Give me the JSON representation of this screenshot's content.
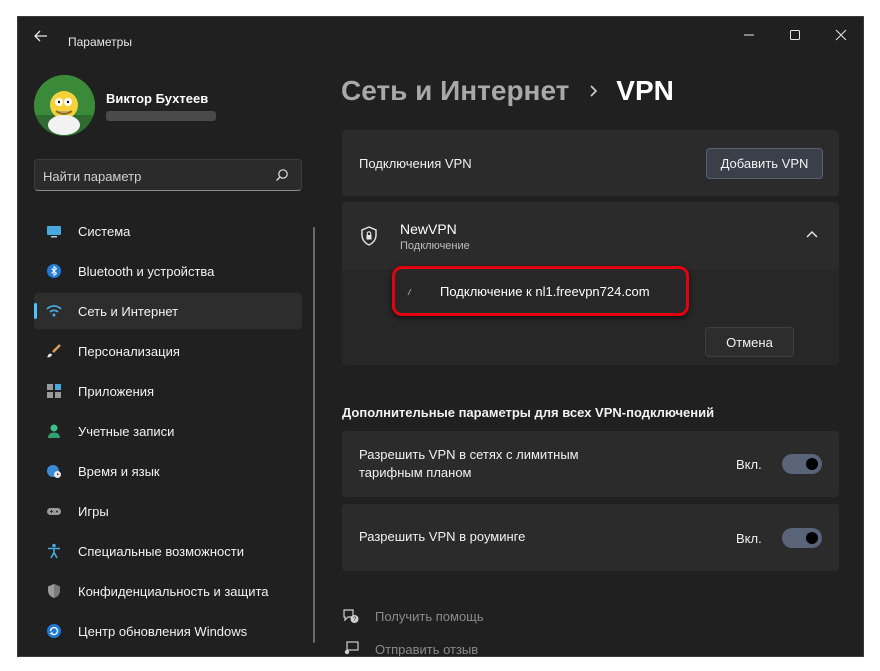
{
  "window": {
    "title": "Параметры",
    "controls": {
      "minimize": "minimize",
      "maximize": "maximize",
      "close": "close"
    }
  },
  "profile": {
    "name": "Виктор Бухтеев"
  },
  "search": {
    "placeholder": "Найти параметр"
  },
  "nav": {
    "items": [
      {
        "label": "Система",
        "icon": "monitor-icon",
        "active": false
      },
      {
        "label": "Bluetooth и устройства",
        "icon": "bluetooth-icon",
        "active": false
      },
      {
        "label": "Сеть и Интернет",
        "icon": "wifi-icon",
        "active": true
      },
      {
        "label": "Персонализация",
        "icon": "brush-icon",
        "active": false
      },
      {
        "label": "Приложения",
        "icon": "apps-icon",
        "active": false
      },
      {
        "label": "Учетные записи",
        "icon": "person-icon",
        "active": false
      },
      {
        "label": "Время и язык",
        "icon": "globe-clock-icon",
        "active": false
      },
      {
        "label": "Игры",
        "icon": "gamepad-icon",
        "active": false
      },
      {
        "label": "Специальные возможности",
        "icon": "accessibility-icon",
        "active": false
      },
      {
        "label": "Конфиденциальность и защита",
        "icon": "shield-icon",
        "active": false
      },
      {
        "label": "Центр обновления Windows",
        "icon": "update-icon",
        "active": false
      }
    ]
  },
  "breadcrumb": {
    "parent": "Сеть и Интернет",
    "current": "VPN"
  },
  "vpn_connections": {
    "label": "Подключения VPN",
    "add_button": "Добавить VPN"
  },
  "vpn_entry": {
    "name": "NewVPN",
    "status": "Подключение",
    "connecting_text": "Подключение к nl1.freevpn724.com",
    "cancel_button": "Отмена"
  },
  "advanced": {
    "title": "Дополнительные параметры для всех VPN-подключений",
    "toggles": [
      {
        "label": "Разрешить VPN в сетях с лимитным тарифным планом",
        "state": "Вкл.",
        "on": true
      },
      {
        "label": "Разрешить VPN в роуминге",
        "state": "Вкл.",
        "on": true
      }
    ]
  },
  "links": {
    "help": "Получить помощь",
    "feedback": "Отправить отзыв"
  },
  "colors": {
    "accent": "#4cc2ff",
    "highlight": "#e3000f",
    "background": "#202020",
    "card": "#2b2b2b"
  }
}
